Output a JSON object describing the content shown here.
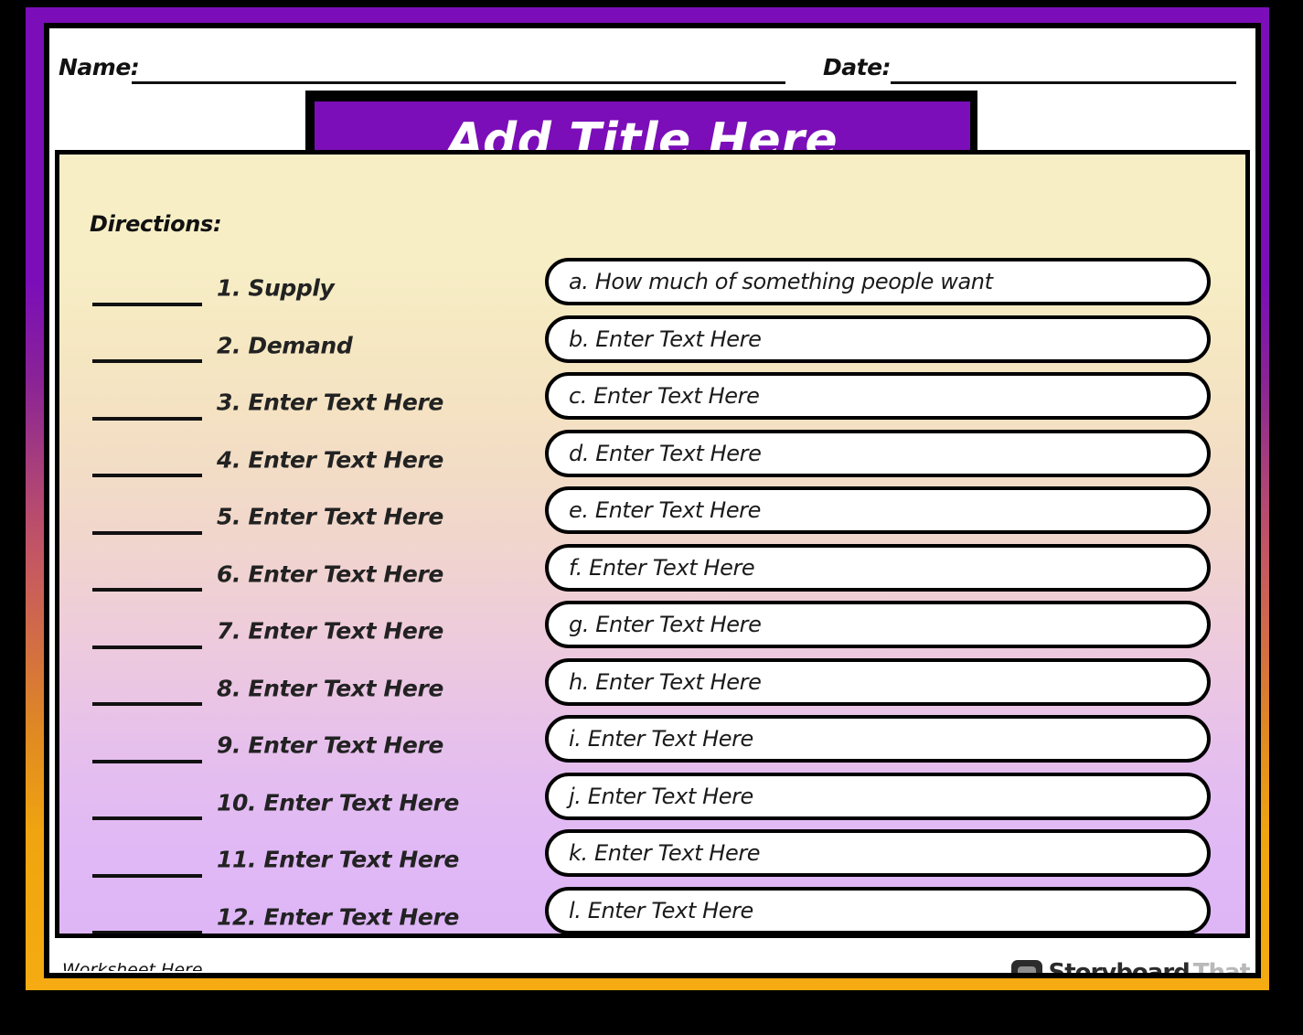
{
  "worksheet": {
    "meta": {
      "name_label": "Name:",
      "date_label": "Date:",
      "name_value": "",
      "date_value": ""
    },
    "title": "Add Title Here",
    "directions_label": "Directions:",
    "numbered_items": [
      {
        "blank": "",
        "text": "1. Supply"
      },
      {
        "blank": "",
        "text": "2. Demand"
      },
      {
        "blank": "",
        "text": "3. Enter Text Here"
      },
      {
        "blank": "",
        "text": "4. Enter Text Here"
      },
      {
        "blank": "",
        "text": "5. Enter Text Here"
      },
      {
        "blank": "",
        "text": "6. Enter Text Here"
      },
      {
        "blank": "",
        "text": "7. Enter Text Here"
      },
      {
        "blank": "",
        "text": "8. Enter Text Here"
      },
      {
        "blank": "",
        "text": "9. Enter Text Here"
      },
      {
        "blank": "",
        "text": "10. Enter Text Here"
      },
      {
        "blank": "",
        "text": "11. Enter Text Here"
      },
      {
        "blank": "",
        "text": "12. Enter Text Here"
      }
    ],
    "answer_items": [
      {
        "text": "a. How much of something people want"
      },
      {
        "text": "b. Enter Text Here"
      },
      {
        "text": "c. Enter Text Here"
      },
      {
        "text": "d. Enter Text Here"
      },
      {
        "text": "e. Enter Text Here"
      },
      {
        "text": "f. Enter Text Here"
      },
      {
        "text": "g. Enter Text Here"
      },
      {
        "text": "h. Enter Text Here"
      },
      {
        "text": "i. Enter Text Here"
      },
      {
        "text": "j. Enter Text Here"
      },
      {
        "text": "k. Enter Text Here"
      },
      {
        "text": "l. Enter Text Here"
      }
    ],
    "bottom_clip_text": "Worksheet Here",
    "watermark": {
      "icon": "speech-bubble-icon",
      "word_primary": "Storyboard",
      "word_secondary": "That"
    },
    "colors": {
      "frame_top": "#7B0EB8",
      "frame_bottom": "#F5AB11",
      "title_plate": "#7B0EB8",
      "title_text": "#FFFFFF",
      "panel_top": "#F7EEC6",
      "panel_bottom": "#DEB6F6",
      "outline": "#000000",
      "answer_box_fill": "#FFFFFF"
    }
  }
}
